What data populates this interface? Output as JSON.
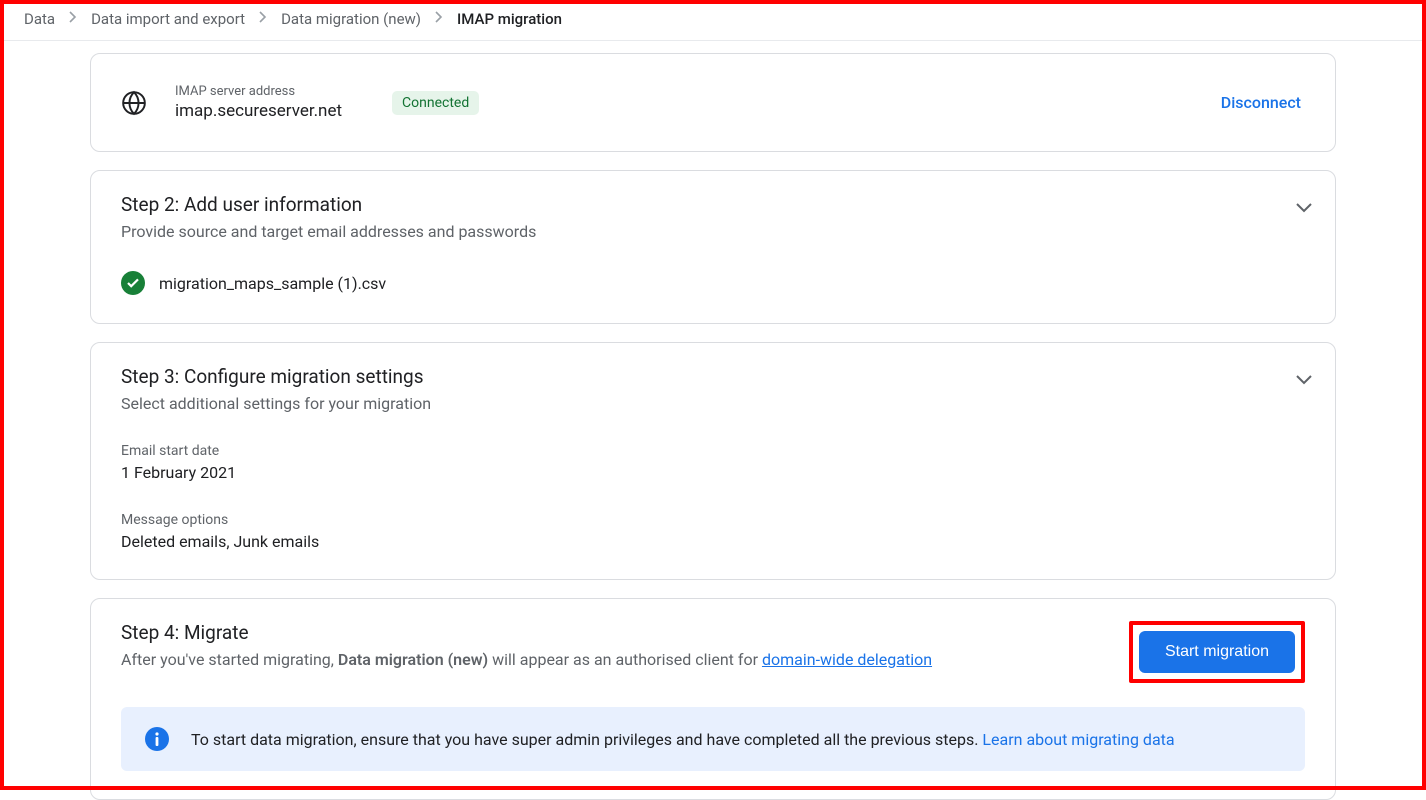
{
  "breadcrumb": {
    "items": [
      {
        "label": "Data"
      },
      {
        "label": "Data import and export"
      },
      {
        "label": "Data migration (new)"
      },
      {
        "label": "IMAP migration"
      }
    ]
  },
  "server": {
    "label": "IMAP server address",
    "value": "imap.secureserver.net",
    "status": "Connected",
    "disconnect": "Disconnect"
  },
  "step2": {
    "title": "Step 2: Add user information",
    "subtitle": "Provide source and target email addresses and passwords",
    "file": "migration_maps_sample (1).csv"
  },
  "step3": {
    "title": "Step 3: Configure migration settings",
    "subtitle": "Select additional settings for your migration",
    "startDateLabel": "Email start date",
    "startDateValue": "1 February 2021",
    "optionsLabel": "Message options",
    "optionsValue": "Deleted emails, Junk emails"
  },
  "step4": {
    "title": "Step 4: Migrate",
    "subPrefix": "After you've started migrating, ",
    "subBold": "Data migration (new)",
    "subMid": " will appear as an authorised client for ",
    "subLink": "domain-wide delegation",
    "startButton": "Start migration",
    "infoText": "To start data migration, ensure that you have super admin privileges and have completed all the previous steps. ",
    "infoLink": "Learn about migrating data"
  }
}
